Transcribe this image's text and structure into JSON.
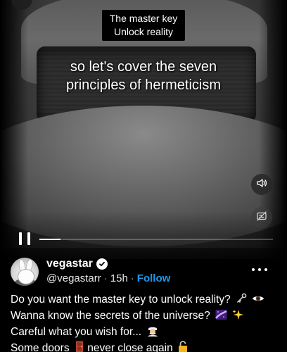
{
  "video": {
    "caption_box": {
      "line1": "The master key",
      "line2": "Unlock reality"
    },
    "subtitle": {
      "line1": "so let's cover the seven",
      "line2": "principles of hermeticism"
    },
    "controls": {
      "volume_icon": "speaker-icon",
      "captions_icon": "captions-off-icon",
      "pause_icon": "pause-icon",
      "progress_fraction": 0.09
    }
  },
  "tweet": {
    "display_name": "vegastar",
    "verified_icon": "verified-badge-icon",
    "handle": "@vegastarr",
    "separator": "·",
    "time": "15h",
    "follow_label": "Follow",
    "more_icon": "more-options-icon",
    "text_lines": [
      {
        "text": "Do you want the master key to unlock reality?",
        "emoji": [
          "key-icon",
          "eye-icon"
        ]
      },
      {
        "text": "Wanna know the secrets of the universe?",
        "emoji": [
          "milky-way-icon",
          "sparkles-icon"
        ]
      },
      {
        "text": "Careful what you wish for...",
        "emoji": [
          "genie-icon"
        ]
      },
      {
        "text_before": "Some doors",
        "text_after": "never close again",
        "emoji": [
          "door-icon",
          "unlocked-icon"
        ]
      }
    ]
  },
  "colors": {
    "accent": "#1d9bf0",
    "text": "#ffffff",
    "background": "#000000"
  }
}
